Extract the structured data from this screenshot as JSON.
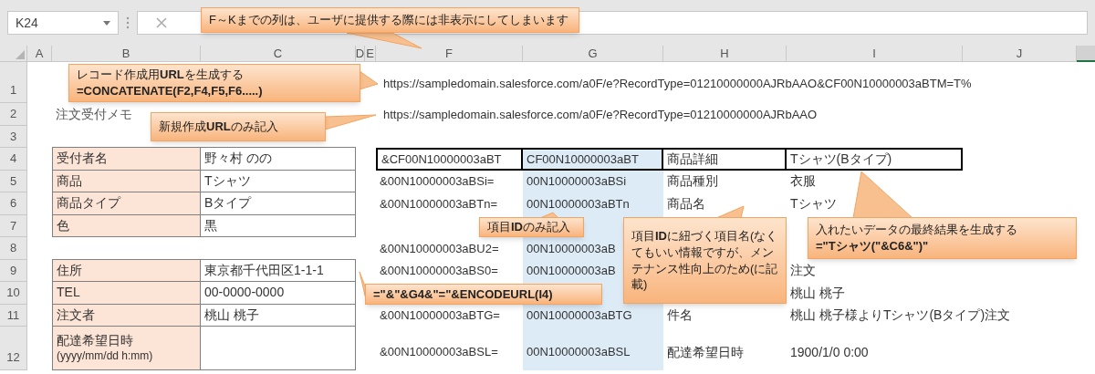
{
  "name_box": "K24",
  "column_headers": [
    "A",
    "B",
    "C",
    "D",
    "E",
    "F",
    "G",
    "H",
    "I",
    "J"
  ],
  "row_numbers": [
    "1",
    "2",
    "3",
    "4",
    "5",
    "6",
    "7",
    "8",
    "9",
    "10",
    "11",
    "12"
  ],
  "urls": [
    "https://sampledomain.salesforce.com/a0F/e?RecordType=01210000000AJRbAAO&CF00N10000003aBTM=T%",
    "https://sampledomain.salesforce.com/a0F/e?RecordType=01210000000AJRbAAO"
  ],
  "memo_title": "注文受付メモ",
  "order_form": [
    [
      {
        "label": "受付者名",
        "value": "野々村 のの"
      },
      {
        "label": "商品",
        "value": "Tシャツ"
      },
      {
        "label": "商品タイプ",
        "value": "Bタイプ"
      },
      {
        "label": "色",
        "value": "黒"
      }
    ],
    [
      {
        "label": "住所",
        "value": "東京都千代田区1-1-1"
      },
      {
        "label": "TEL",
        "value": "00-0000-0000"
      },
      {
        "label": "注文者",
        "value": "桃山 桃子"
      },
      {
        "label": "配達希望日時",
        "sublabel": "(yyyy/mm/dd h:mm)"
      }
    ]
  ],
  "mapping_rows": [
    {
      "param": "&CF00N10000003aBT",
      "field_id": "CF00N10000003aBT",
      "field_name": "商品詳細",
      "value": "Tシャツ(Bタイプ)",
      "boxed": true
    },
    {
      "param": "&00N10000003aBSi=",
      "field_id": "00N10000003aBSi",
      "field_name": "商品種別",
      "value": "衣服",
      "boxed": false
    },
    {
      "param": "&00N10000003aBTn=",
      "field_id": "00N10000003aBTn",
      "field_name": "商品名",
      "value": "Tシャツ",
      "boxed": false
    },
    {
      "boxed": false
    },
    {
      "param": "&00N10000003aBU2=",
      "field_id": "00N10000003aB",
      "boxed": false
    },
    {
      "param": "&00N10000003aBS0=",
      "field_id": "00N10000003aB",
      "value": "注文",
      "boxed": false
    },
    {
      "value": "桃山 桃子",
      "boxed": false
    },
    {
      "param": "&00N10000003aBTG=",
      "field_id": "00N10000003aBTG",
      "field_name": "件名",
      "value": "桃山 桃子様よりTシャツ(Bタイプ)注文",
      "boxed": false
    },
    {
      "param": "&00N10000003aBSL=",
      "field_id": "00N10000003aBSL",
      "field_name": "配達希望日時",
      "value": "1900/1/0 0:00",
      "boxed": false
    }
  ],
  "callouts": [
    {
      "lines": [
        "F～Kまでの列は、ユーザに提供する際には非表示にしてしまいます"
      ]
    },
    {
      "lines": [
        "レコード作成用**URL**を生成する",
        "**=CONCATENATE(F2,F4,F5,F6.....)**"
      ]
    },
    {
      "lines": [
        "新規作成**URL**のみ記入"
      ]
    },
    {
      "lines": [
        "項目**ID**のみ記入"
      ]
    },
    {
      "lines": [
        "**=\"&\"&G4&\"=\"&ENCODEURL(I4)**"
      ]
    },
    {
      "lines": [
        "項目**ID**に紐づく項目名(なくてもいい情報ですが、メンテナンス性向上のため(に記載)"
      ]
    },
    {
      "lines": [
        "入れたいデータの最終結果を生成する",
        "**=\"Tシャツ(\"&C6&\")\"**"
      ]
    }
  ]
}
